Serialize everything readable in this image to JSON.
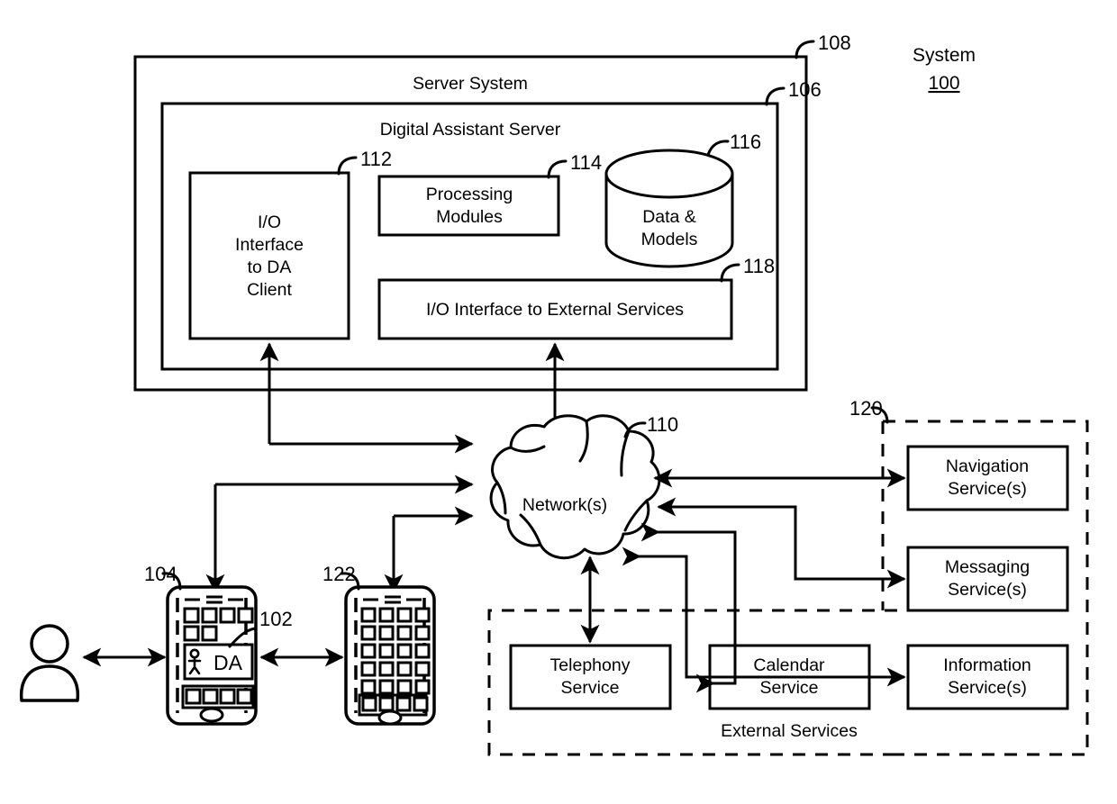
{
  "diagram": {
    "title_label": "System",
    "title_ref": "100",
    "server_system": {
      "label": "Server System",
      "ref": "108"
    },
    "digital_assistant_server": {
      "label": "Digital Assistant Server",
      "ref": "106",
      "components": [
        {
          "label_lines": [
            "I/O",
            "Interface",
            "to DA",
            "Client"
          ],
          "ref": "112",
          "name": "io-interface-da-client"
        },
        {
          "label_lines": [
            "Processing",
            "Modules"
          ],
          "ref": "114",
          "name": "processing-modules"
        },
        {
          "label_lines": [
            "Data &",
            "Models"
          ],
          "ref": "116",
          "name": "data-and-models"
        },
        {
          "label_lines": [
            "I/O Interface to External Services"
          ],
          "ref": "118",
          "name": "io-interface-external-services"
        }
      ]
    },
    "network": {
      "label": "Network(s)",
      "ref": "110"
    },
    "devices": [
      {
        "name": "user-device-primary",
        "ref": "104",
        "assistant_label": "DA",
        "assistant_ref": "102"
      },
      {
        "name": "user-device-secondary",
        "ref": "122"
      }
    ],
    "external_services_right": {
      "ref": "120",
      "services": [
        {
          "label_lines": [
            "Navigation",
            "Service(s)"
          ],
          "name": "navigation-service"
        },
        {
          "label_lines": [
            "Messaging",
            "Service(s)"
          ],
          "name": "messaging-service"
        },
        {
          "label_lines": [
            "Information",
            "Service(s)"
          ],
          "name": "information-service"
        }
      ]
    },
    "external_services_bottom": {
      "label": "External Services",
      "services": [
        {
          "label_lines": [
            "Telephony",
            "Service"
          ],
          "name": "telephony-service"
        },
        {
          "label_lines": [
            "Calendar",
            "Service"
          ],
          "name": "calendar-service"
        }
      ]
    },
    "colors": {
      "stroke": "#000000",
      "background": "#ffffff"
    }
  }
}
